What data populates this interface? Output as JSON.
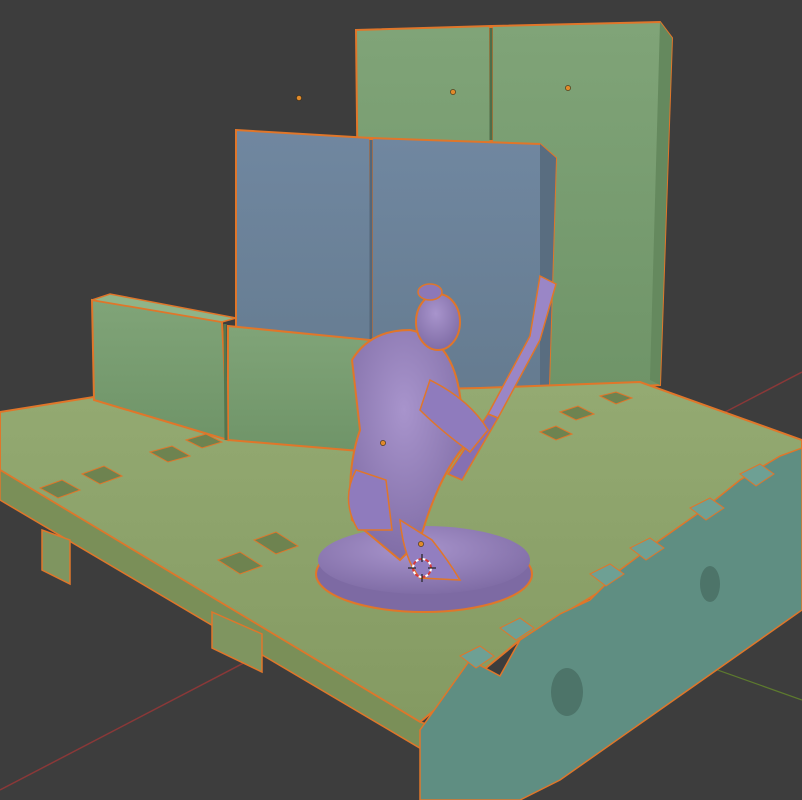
{
  "viewport": {
    "background": "#3d3d3d",
    "colors": {
      "green_wall": "#7da074",
      "blue_wall": "#6c8194",
      "floor": "#8aa068",
      "teal_edge": "#5f8e82",
      "figure": "#9782bc",
      "selection_outline": "#e0762a",
      "origin_dot": "#e08a2a",
      "axis_red": "#8a3838",
      "axis_green": "#5d7a2e"
    }
  },
  "scene": {
    "objects": [
      {
        "id": "back-wall",
        "kind": "green-wall-panel",
        "selected": true
      },
      {
        "id": "middle-wall",
        "kind": "blue-wall-panel",
        "selected": true
      },
      {
        "id": "low-wall",
        "kind": "green-wall-panel",
        "selected": true
      },
      {
        "id": "floor-tile",
        "kind": "floor-tile",
        "selected": true
      },
      {
        "id": "front-connector",
        "kind": "teal-crenellated-edge",
        "selected": false
      },
      {
        "id": "samurai-miniature",
        "kind": "figure-with-base",
        "selected": true
      }
    ],
    "cursor": "3d-cursor"
  }
}
